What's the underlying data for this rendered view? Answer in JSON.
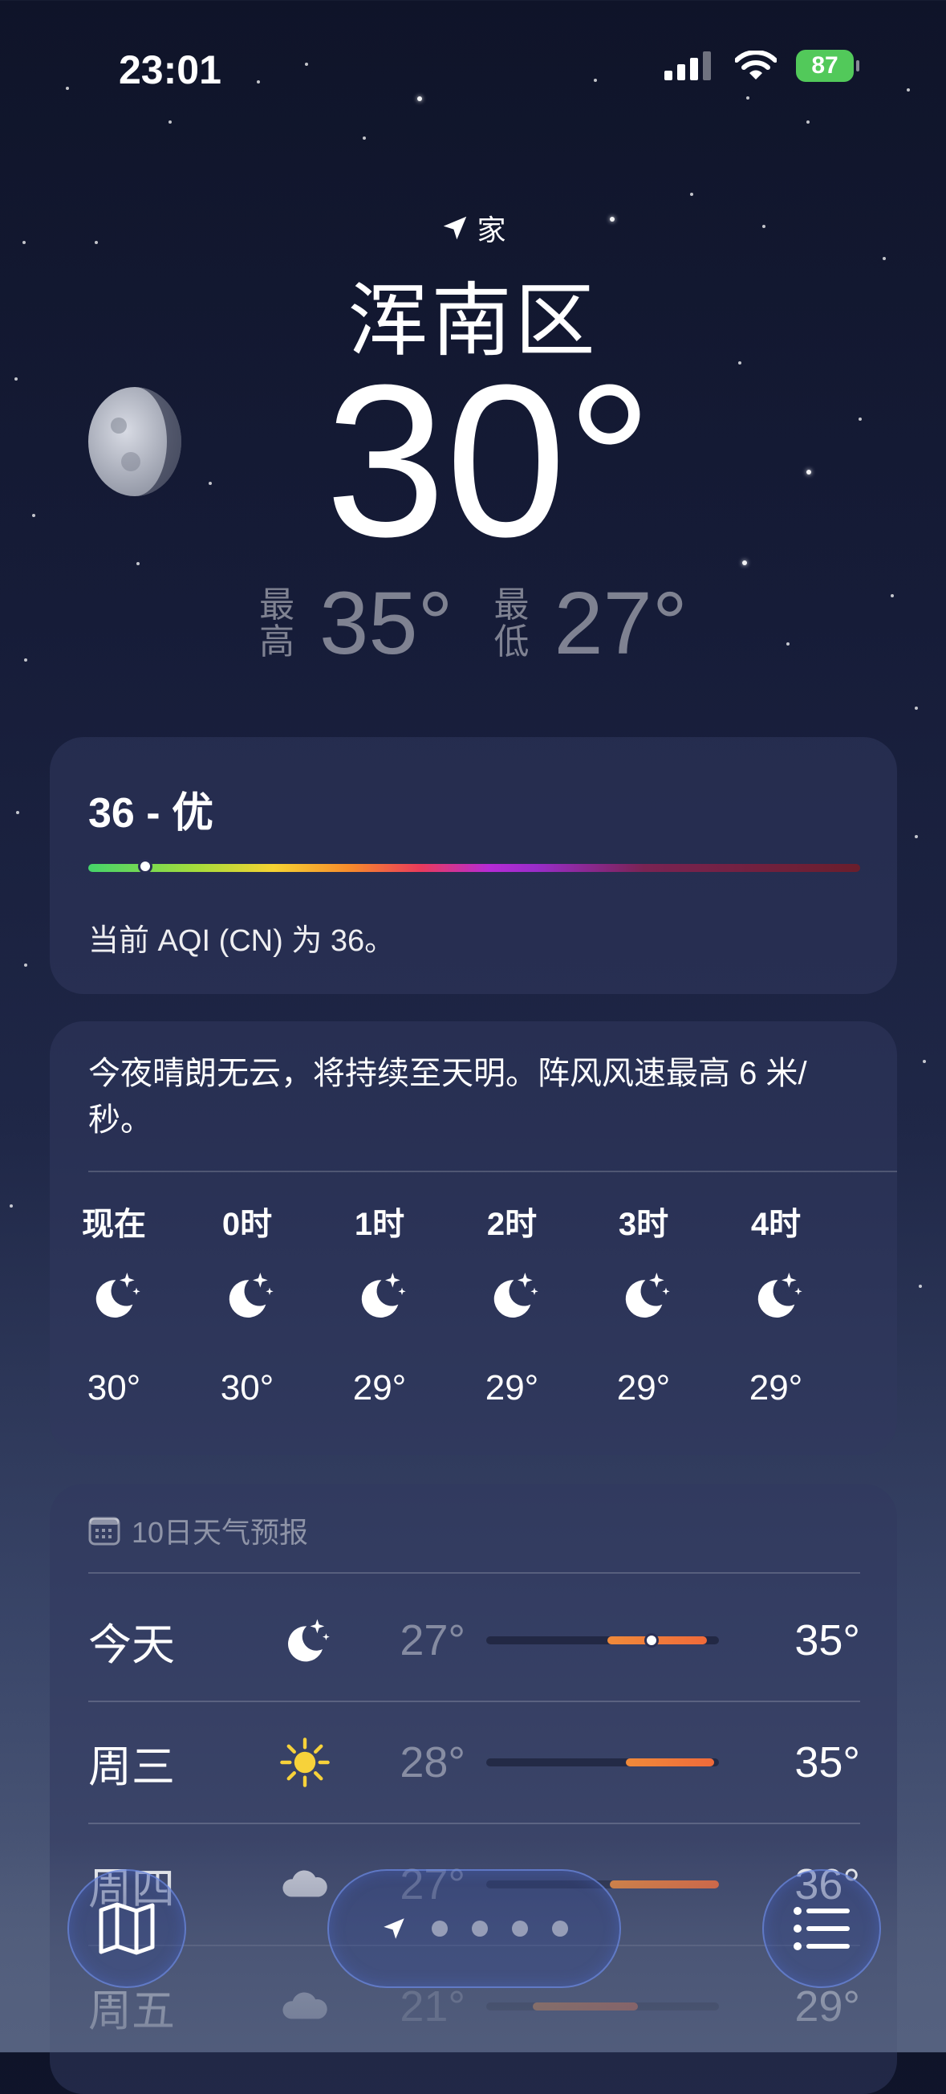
{
  "status_bar": {
    "time": "23:01",
    "battery": "87"
  },
  "location": {
    "label": "家",
    "city": "浑南区"
  },
  "current": {
    "temp": "30°",
    "high_label": "最高",
    "high": "35°",
    "low_label": "最低",
    "low": "27°"
  },
  "aqi": {
    "title": "36 - 优",
    "description": "当前 AQI (CN) 为 36。",
    "level": 0.05
  },
  "hourly": {
    "summary": "今夜晴朗无云，将持续至天明。阵风风速最高 6 米/秒。",
    "items": [
      {
        "label": "现在",
        "icon": "moon-stars-icon",
        "temp": "30°"
      },
      {
        "label": "0时",
        "icon": "moon-stars-icon",
        "temp": "30°"
      },
      {
        "label": "1时",
        "icon": "moon-stars-icon",
        "temp": "29°"
      },
      {
        "label": "2时",
        "icon": "moon-stars-icon",
        "temp": "29°"
      },
      {
        "label": "3时",
        "icon": "moon-stars-icon",
        "temp": "29°"
      },
      {
        "label": "4时",
        "icon": "moon-stars-icon",
        "temp": "29°"
      }
    ]
  },
  "forecast": {
    "title": "10日天气预报",
    "days": [
      {
        "day": "今天",
        "icon": "moon-stars-icon",
        "low": "27°",
        "high": "35°"
      },
      {
        "day": "周三",
        "icon": "sun-icon",
        "low": "28°",
        "high": "35°"
      },
      {
        "day": "周四",
        "icon": "cloud-icon",
        "low": "27°",
        "high": "36°"
      },
      {
        "day": "周五",
        "icon": "cloud-icon",
        "low": "21°",
        "high": "29°"
      }
    ]
  },
  "colors": {
    "accent_green": "#52c95a",
    "bar_orange": "#f06a3a"
  }
}
